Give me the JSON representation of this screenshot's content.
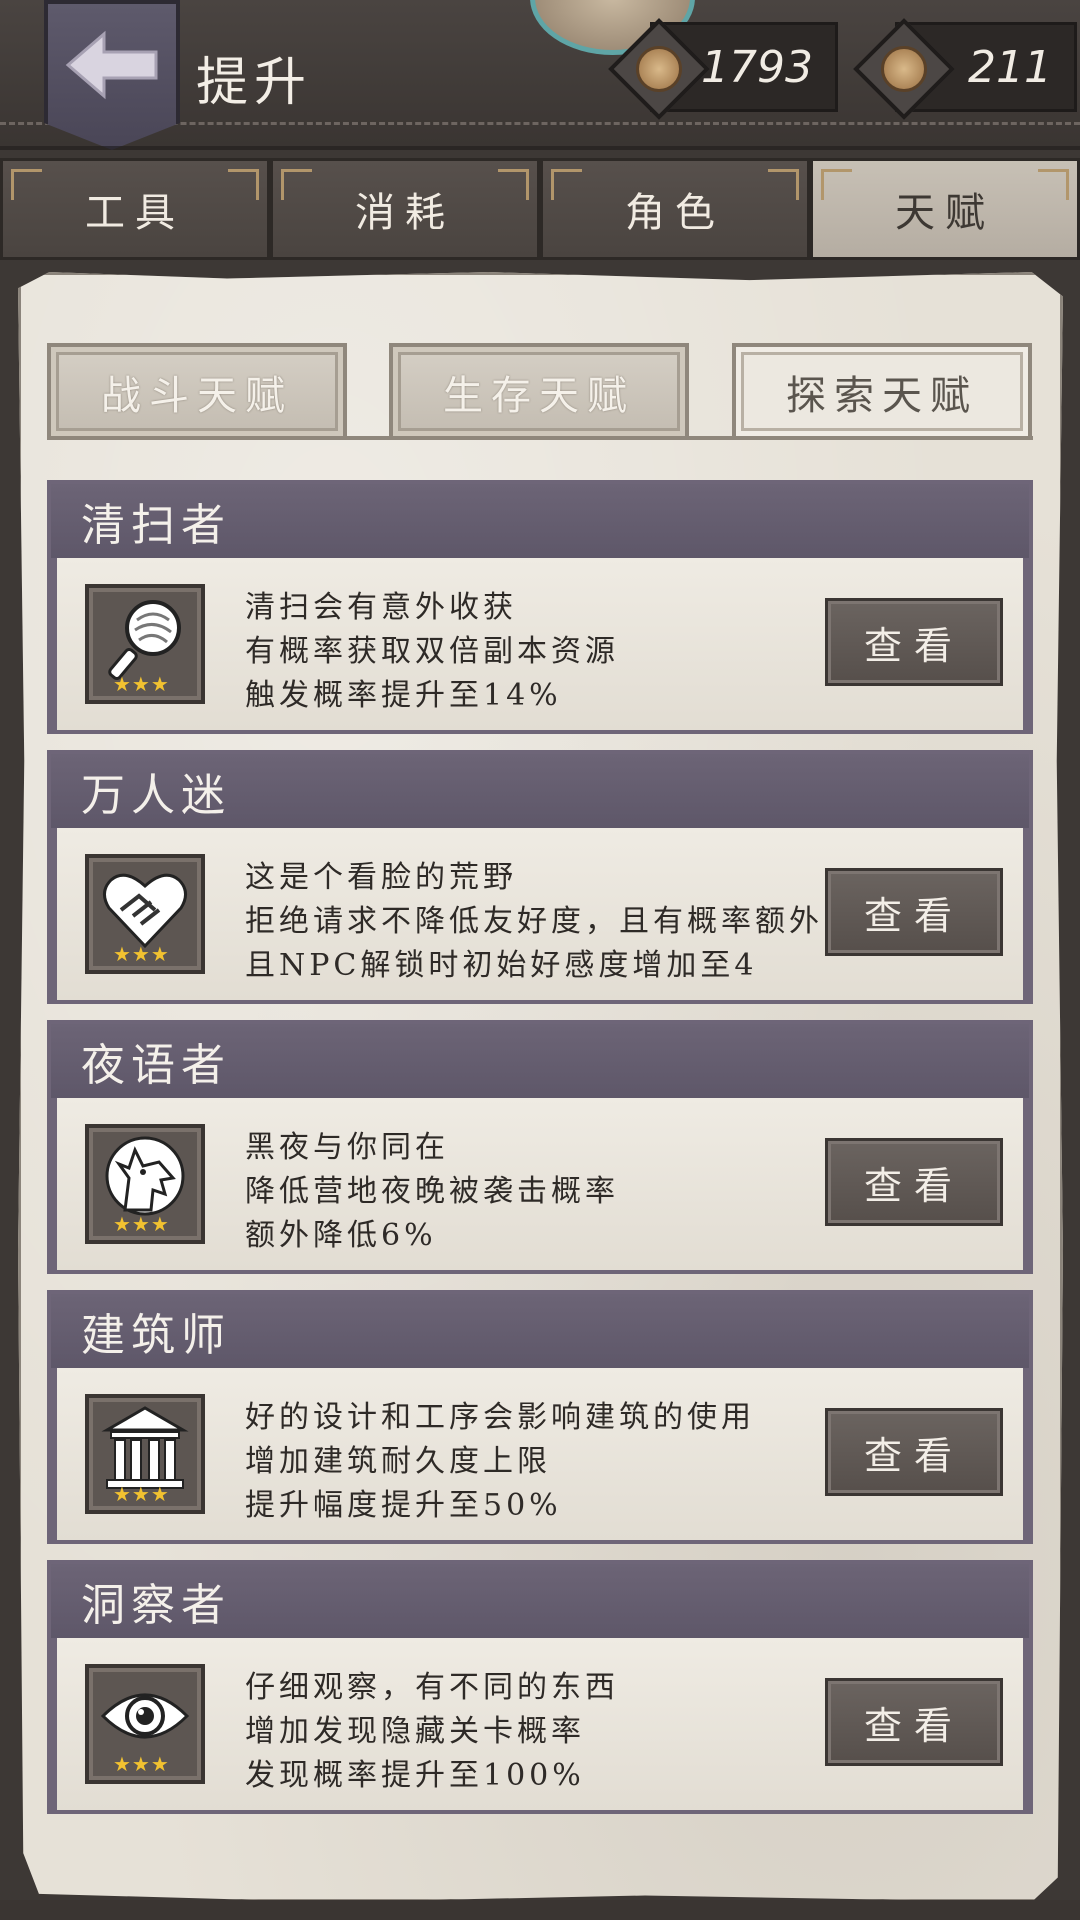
{
  "header": {
    "title": "提升",
    "back_icon": "back-arrow-icon",
    "currencies": [
      {
        "icon": "coin-icon",
        "value": "1793"
      },
      {
        "icon": "token-icon",
        "value": "211"
      }
    ]
  },
  "tabs": [
    {
      "label": "工具",
      "active": false
    },
    {
      "label": "消耗",
      "active": false
    },
    {
      "label": "角色",
      "active": false
    },
    {
      "label": "天赋",
      "active": true
    }
  ],
  "subtabs": [
    {
      "label": "战斗天赋",
      "active": false
    },
    {
      "label": "生存天赋",
      "active": false
    },
    {
      "label": "探索天赋",
      "active": true
    }
  ],
  "talents": [
    {
      "name": "清扫者",
      "icon": "magnifier-icon",
      "stars": "★★★",
      "lines": [
        "清扫会有意外收获",
        "有概率获取双倍副本资源",
        "触发概率提升至14%"
      ],
      "button": "查看"
    },
    {
      "name": "万人迷",
      "icon": "handshake-heart-icon",
      "stars": "★★★",
      "lines": [
        "这是个看脸的荒野",
        "拒绝请求不降低友好度，且有概率额外",
        "且NPC解锁时初始好感度增加至4"
      ],
      "button": "查看"
    },
    {
      "name": "夜语者",
      "icon": "wolf-icon",
      "stars": "★★★",
      "lines": [
        "黑夜与你同在",
        "降低营地夜晚被袭击概率",
        "额外降低6%"
      ],
      "button": "查看"
    },
    {
      "name": "建筑师",
      "icon": "building-icon",
      "stars": "★★★",
      "lines": [
        "好的设计和工序会影响建筑的使用",
        "增加建筑耐久度上限",
        "提升幅度提升至50%"
      ],
      "button": "查看"
    },
    {
      "name": "洞察者",
      "icon": "eye-icon",
      "stars": "★★★",
      "lines": [
        "仔细观察，有不同的东西",
        "增加发现隐藏关卡概率",
        "发现概率提升至100%"
      ],
      "button": "查看"
    }
  ]
}
